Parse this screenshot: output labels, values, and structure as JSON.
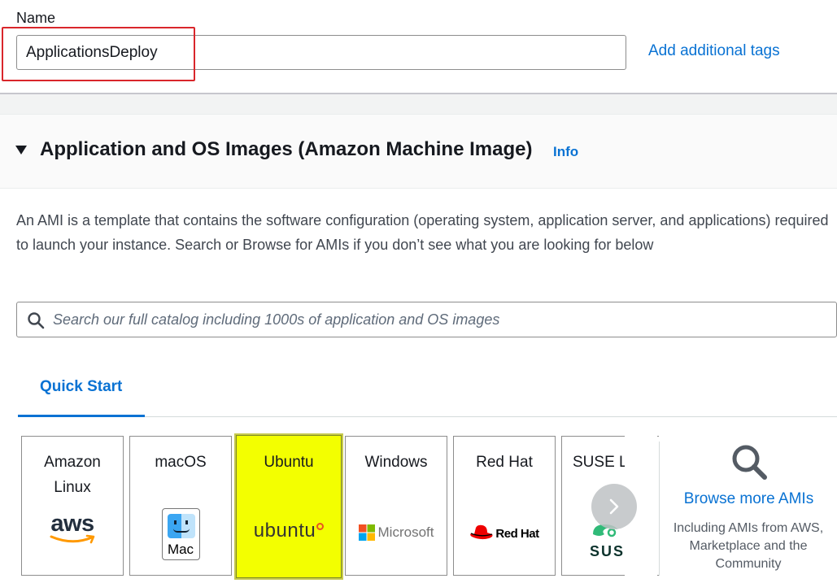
{
  "name_field": {
    "label": "Name",
    "value": "ApplicationsDeploy",
    "add_tags_link": "Add additional tags"
  },
  "section": {
    "title": "Application and OS Images (Amazon Machine Image)",
    "info_link": "Info",
    "description": "An AMI is a template that contains the software configuration (operating system, application server, and applications) required to launch your instance. Search or Browse for AMIs if you don’t see what you are looking for below"
  },
  "search": {
    "placeholder": "Search our full catalog including 1000s of application and OS images",
    "icon": "search-icon"
  },
  "tabs": [
    {
      "label": "Quick Start",
      "active": true
    }
  ],
  "ami_cards": [
    {
      "label": "Amazon Linux",
      "logo_text": "aws",
      "selected": false
    },
    {
      "label": "macOS",
      "logo_text": "Mac",
      "selected": false
    },
    {
      "label": "Ubuntu",
      "logo_text": "ubuntu",
      "selected": true
    },
    {
      "label": "Windows",
      "logo_text": "Microsoft",
      "selected": false
    },
    {
      "label": "Red Hat",
      "logo_text": "Red Hat",
      "selected": false
    },
    {
      "label": "SUSE Li",
      "logo_text": "SUS",
      "selected": false
    }
  ],
  "browse": {
    "link": "Browse more AMIs",
    "description": "Including AMIs from AWS, Marketplace and the Community"
  },
  "colors": {
    "link": "#0972d3",
    "highlight_selected": "#f3ff00",
    "red_annotation": "#d9262b",
    "text": "#16191f"
  }
}
